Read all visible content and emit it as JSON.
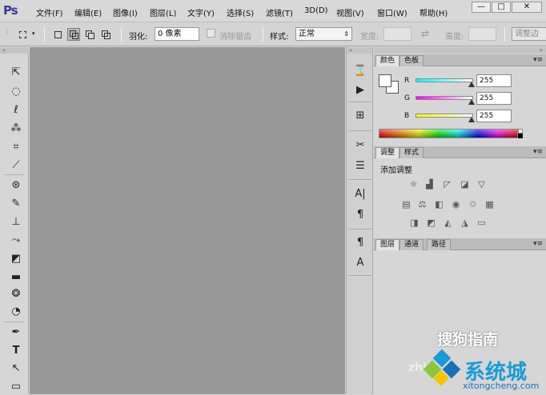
{
  "app": {
    "logo": "Ps"
  },
  "menu": {
    "items": [
      "文件(F)",
      "编辑(E)",
      "图像(I)",
      "图层(L)",
      "文字(Y)",
      "选择(S)",
      "滤镜(T)",
      "3D(D)",
      "视图(V)",
      "窗口(W)",
      "帮助(H)"
    ]
  },
  "window_controls": {
    "minimize": "—",
    "maximize": "□",
    "close": "✕"
  },
  "options": {
    "feather_label": "羽化:",
    "feather_value": "0 像素",
    "antialias_label": "消除锯齿",
    "style_label": "样式:",
    "style_value": "正常",
    "width_label": "宽度:",
    "height_label": "高度:",
    "refine_edge": "调整边"
  },
  "color_panel": {
    "tabs": [
      "颜色",
      "色板"
    ],
    "r_label": "R",
    "g_label": "G",
    "b_label": "B",
    "r_value": "255",
    "g_value": "255",
    "b_value": "255"
  },
  "adjust_panel": {
    "tabs": [
      "调整",
      "样式"
    ],
    "title": "添加调整"
  },
  "layers_panel": {
    "tabs": [
      "图层",
      "通道",
      "路径"
    ]
  },
  "watermark": {
    "text1": "搜狗指南",
    "text2": "系统城",
    "text3": "xitongcheng.com",
    "text4": "zhi"
  },
  "colors": {
    "canvas": "#999999",
    "ui_bg": "#d6d6d6",
    "logo": "#3a3a9a",
    "watermark_blue": "#1a9ad6"
  }
}
